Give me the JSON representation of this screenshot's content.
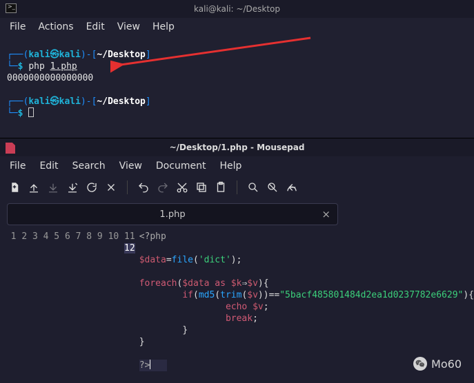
{
  "terminal": {
    "title": "kali@kali: ~/Desktop",
    "menu": {
      "file": "File",
      "actions": "Actions",
      "edit": "Edit",
      "view": "View",
      "help": "Help"
    },
    "prompt1_user": "kali㉿kali",
    "prompt1_path": "~/Desktop",
    "command1_cmd": "php",
    "command1_arg": "1.php",
    "output1": "0000000000000000",
    "prompt2_user": "kali㉿kali",
    "prompt2_path": "~/Desktop",
    "prompt_symbol": "$"
  },
  "mousepad": {
    "title": "~/Desktop/1.php - Mousepad",
    "menu": {
      "file": "File",
      "edit": "Edit",
      "search": "Search",
      "view": "View",
      "document": "Document",
      "help": "Help"
    },
    "tab_label": "1.php",
    "code": {
      "l1": "<?php",
      "l3_var": "$data",
      "l3_func": "file",
      "l3_str": "'dict'",
      "l5_kw": "foreach",
      "l5_var1": "$data",
      "l5_as": "as",
      "l5_var2": "$k",
      "l5_arrow": "⇒",
      "l5_var3": "$v",
      "l6_if": "if",
      "l6_md5": "md5",
      "l6_trim": "trim",
      "l6_var": "$v",
      "l6_eq": "==",
      "l6_str": "\"5bacf485801484d2ea1d0237782e6629\"",
      "l7_echo": "echo",
      "l7_var": "$v",
      "l8_break": "break",
      "l12": "?>"
    },
    "line_numbers": [
      "1",
      "2",
      "3",
      "4",
      "5",
      "6",
      "7",
      "8",
      "9",
      "10",
      "11",
      "12"
    ]
  },
  "watermark": {
    "text": "Mo60"
  }
}
